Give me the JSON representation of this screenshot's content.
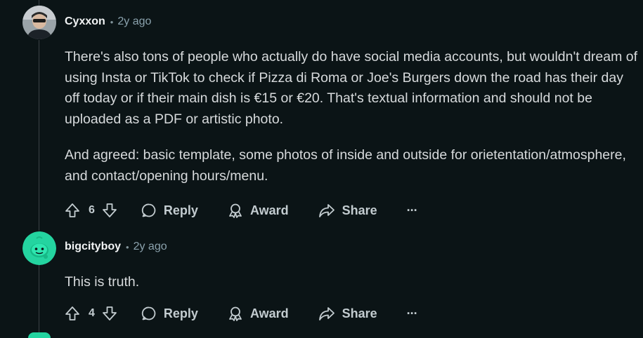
{
  "comments": [
    {
      "author": "Cyxxon",
      "time": "2y ago",
      "paragraphs": [
        "There's also tons of people who actually do have social media accounts, but wouldn't dream of using Insta or TikTok to check if Pizza di Roma or Joe's Burgers down the road has their day off today or if their main dish is €15 or €20. That's textual information and should not be uploaded as a PDF or artistic photo.",
        "And agreed: basic template, some photos of inside and outside for orietentation/atmosphere, and contact/opening hours/menu."
      ],
      "votes": "6",
      "reply_label": "Reply",
      "award_label": "Award",
      "share_label": "Share",
      "more_label": "···",
      "avatar_icon": "user-photo-avatar"
    },
    {
      "author": "bigcityboy",
      "time": "2y ago",
      "paragraphs": [
        "This is truth."
      ],
      "votes": "4",
      "reply_label": "Reply",
      "award_label": "Award",
      "share_label": "Share",
      "more_label": "···",
      "avatar_icon": "snoo-avatar",
      "avatar_color": "#24d4a0"
    }
  ],
  "colors": {
    "background": "#0b1416",
    "text": "#d7dadc",
    "meta": "#8ba2ad",
    "thread_line": "#3a4145"
  }
}
